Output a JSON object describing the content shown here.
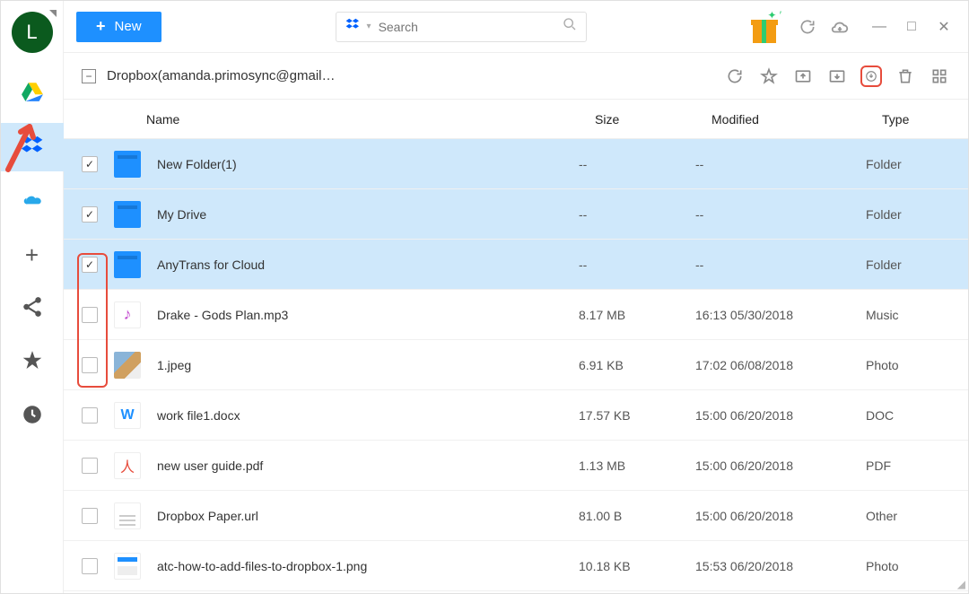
{
  "avatar_letter": "L",
  "topbar": {
    "new_label": "New",
    "search_placeholder": "Search"
  },
  "path": {
    "collapse_symbol": "−",
    "text": "Dropbox(amanda.primosync@gmail…"
  },
  "columns": {
    "name": "Name",
    "size": "Size",
    "modified": "Modified",
    "type": "Type"
  },
  "rows": [
    {
      "selected": true,
      "icon": "folder",
      "name": "New Folder(1)",
      "size": "--",
      "modified": "--",
      "type": "Folder"
    },
    {
      "selected": true,
      "icon": "folder",
      "name": "My Drive",
      "size": "--",
      "modified": "--",
      "type": "Folder"
    },
    {
      "selected": true,
      "icon": "folder",
      "name": "AnyTrans for Cloud",
      "size": "--",
      "modified": "--",
      "type": "Folder"
    },
    {
      "selected": false,
      "icon": "music",
      "name": "Drake - Gods Plan.mp3",
      "size": "8.17 MB",
      "modified": "16:13 05/30/2018",
      "type": "Music"
    },
    {
      "selected": false,
      "icon": "photo",
      "name": "1.jpeg",
      "size": "6.91 KB",
      "modified": "17:02 06/08/2018",
      "type": "Photo"
    },
    {
      "selected": false,
      "icon": "doc",
      "name": "work file1.docx",
      "size": "17.57 KB",
      "modified": "15:00 06/20/2018",
      "type": "DOC"
    },
    {
      "selected": false,
      "icon": "pdf",
      "name": "new user guide.pdf",
      "size": "1.13 MB",
      "modified": "15:00 06/20/2018",
      "type": "PDF"
    },
    {
      "selected": false,
      "icon": "url",
      "name": "Dropbox Paper.url",
      "size": "81.00 B",
      "modified": "15:00 06/20/2018",
      "type": "Other"
    },
    {
      "selected": false,
      "icon": "png",
      "name": "atc-how-to-add-files-to-dropbox-1.png",
      "size": "10.18 KB",
      "modified": "15:53 06/20/2018",
      "type": "Photo"
    }
  ],
  "icons": {
    "music_glyph": "♪",
    "doc_glyph": "W",
    "pdf_glyph": "人"
  }
}
